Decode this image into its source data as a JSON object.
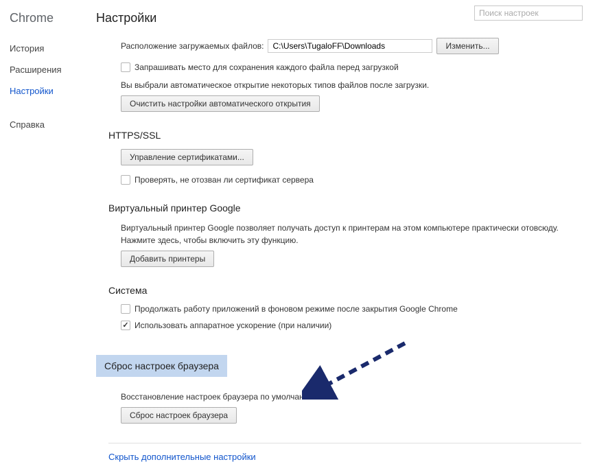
{
  "brand": "Chrome",
  "nav": {
    "history": "История",
    "extensions": "Расширения",
    "settings": "Настройки",
    "help": "Справка"
  },
  "page_title": "Настройки",
  "search_placeholder": "Поиск настроек",
  "downloads": {
    "location_label": "Расположение загружаемых файлов:",
    "path_value": "C:\\Users\\TugaloFF\\Downloads",
    "change_btn": "Изменить...",
    "ask_label": "Запрашивать место для сохранения каждого файла перед загрузкой",
    "autoopen_help": "Вы выбрали автоматическое открытие некоторых типов файлов после загрузки.",
    "clear_autoopen_btn": "Очистить настройки автоматического открытия"
  },
  "https": {
    "title": "HTTPS/SSL",
    "manage_btn": "Управление сертификатами...",
    "revoke_label": "Проверять, не отозван ли сертификат сервера"
  },
  "cloudprint": {
    "title": "Виртуальный принтер Google",
    "desc": "Виртуальный принтер Google позволяет получать доступ к принтерам на этом компьютере практически отовсюду. Нажмите здесь, чтобы включить эту функцию.",
    "add_btn": "Добавить принтеры"
  },
  "system": {
    "title": "Система",
    "bg_label": "Продолжать работу приложений в фоновом режиме после закрытия Google Chrome",
    "hw_label": "Использовать аппаратное ускорение (при наличии)"
  },
  "reset": {
    "title": "Сброс настроек браузера",
    "desc": "Восстановление настроек браузера по умолчанию.",
    "btn": "Сброс настроек браузера"
  },
  "footer_link": "Скрыть дополнительные настройки"
}
